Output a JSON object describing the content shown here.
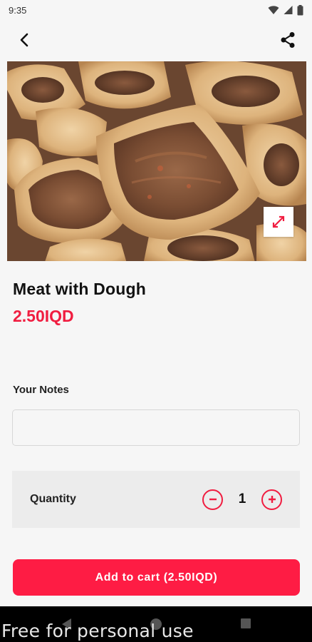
{
  "status_bar": {
    "time": "9:35"
  },
  "product": {
    "name": "Meat with Dough",
    "price": "2.50IQD"
  },
  "notes": {
    "label": "Your Notes",
    "value": "",
    "placeholder": ""
  },
  "quantity": {
    "label": "Quantity",
    "value": "1"
  },
  "cart": {
    "label": "Add to cart (2.50IQD)"
  },
  "watermark": "Free for personal use",
  "colors": {
    "accent": "#f01d40",
    "button": "#fe1c44",
    "background": "#f6f6f6",
    "quantity_box": "#ececec"
  },
  "icons": [
    "wifi-icon",
    "signal-icon",
    "battery-icon",
    "back-arrow-icon",
    "share-icon",
    "expand-icon",
    "minus-icon",
    "plus-icon",
    "nav-back-icon",
    "nav-home-icon",
    "nav-recent-icon"
  ]
}
